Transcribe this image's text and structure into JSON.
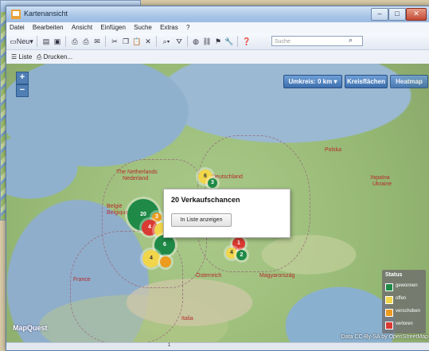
{
  "window": {
    "title": "Kartenansicht"
  },
  "menu": [
    "Datei",
    "Bearbeiten",
    "Ansicht",
    "Einfügen",
    "Suche",
    "Extras",
    "?"
  ],
  "toolbar": {
    "new_label": "Neu",
    "search_placeholder": "Suche"
  },
  "toolbar2": {
    "list_label": "Liste",
    "print_label": "Drucken..."
  },
  "map": {
    "radius_button": "Umkreis: 0 km",
    "circles_button": "Kreisflächen",
    "heatmap_button": "Heatmap",
    "labels": [
      "The Netherlands",
      "Nederland",
      "Deutschland",
      "Polska",
      "België",
      "Belgique",
      "France",
      "Österreich",
      "Magyarország",
      "Italia",
      "Україна",
      "Ukraine"
    ],
    "clusters": [
      "20",
      "3",
      "4",
      "6",
      "4",
      "2",
      "1",
      "3"
    ],
    "logo": "MapQuest",
    "attribution": "Data CC-By-SA by OpenStreetMap"
  },
  "popup": {
    "title": "20 Verkaufschancen",
    "button": "In Liste anzeigen"
  },
  "legend": {
    "title": "Status",
    "items": [
      {
        "label": "gewonnen",
        "color": "#1f8a47"
      },
      {
        "label": "offen",
        "color": "#f1d54a"
      },
      {
        "label": "verschoben",
        "color": "#ec9b1e"
      },
      {
        "label": "verloren",
        "color": "#d93a32"
      }
    ]
  },
  "statusbar": {
    "text": "1"
  }
}
